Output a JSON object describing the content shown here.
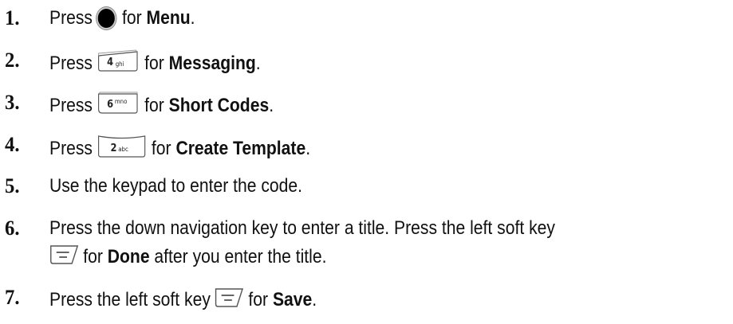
{
  "steps": [
    {
      "num": "1.",
      "pre": "Press",
      "key_icon": "center-select-key-icon",
      "post": "for",
      "bold": "Menu",
      "end": "."
    },
    {
      "num": "2.",
      "pre": "Press",
      "key_icon": "4-ghi-key-icon",
      "key_main": "4",
      "key_sub": "ghi",
      "post": "for",
      "bold": "Messaging",
      "end": "."
    },
    {
      "num": "3.",
      "pre": "Press",
      "key_icon": "6-mno-key-icon",
      "key_main": "6",
      "key_sub": "mno",
      "post": "for",
      "bold": "Short Codes",
      "end": "."
    },
    {
      "num": "4.",
      "pre": "Press",
      "key_icon": "2-abc-key-icon",
      "key_main": "2",
      "key_sub": "abc",
      "post": "for",
      "bold": "Create Template",
      "end": "."
    },
    {
      "num": "5.",
      "text": "Use the keypad to enter the code."
    },
    {
      "num": "6.",
      "line1": "Press the down navigation key to enter a title. Press the left soft key",
      "key_icon": "left-soft-key-icon",
      "post": "for",
      "bold": "Done",
      "end": "after you enter the title."
    },
    {
      "num": "7.",
      "pre": "Press the left soft key",
      "key_icon": "left-soft-key-icon",
      "post": "for",
      "bold": "Save",
      "end": "."
    }
  ]
}
